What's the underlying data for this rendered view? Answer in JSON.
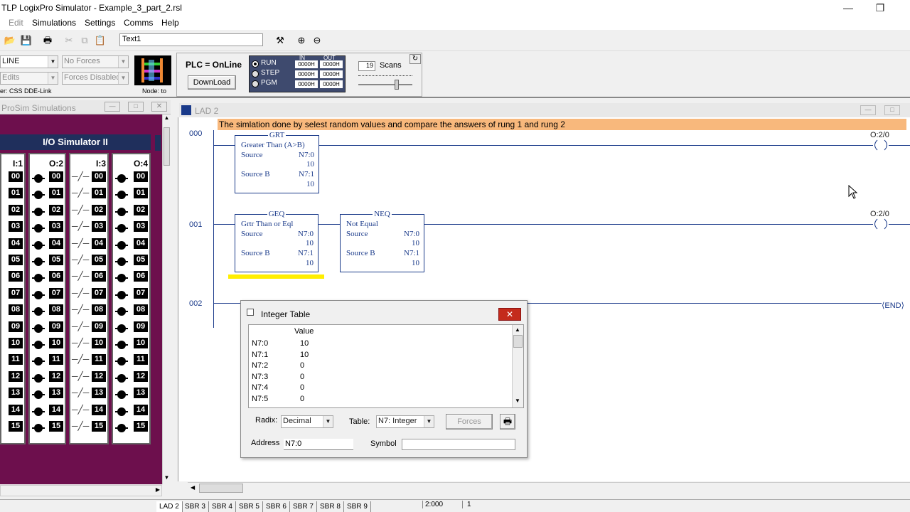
{
  "window": {
    "title": "TLP LogixPro Simulator  -  Example_3_part_2.rsl"
  },
  "menu": [
    "Edit",
    "Simulations",
    "Settings",
    "Comms",
    "Help"
  ],
  "toolbar": {
    "text_field": "Text1"
  },
  "controls": {
    "mode_combo": "LINE",
    "edits_combo": "Edits",
    "forces_combo": "No Forces",
    "forces_enable_combo": "Forces Disabled",
    "driver_label": "er: CSS DDE-Link",
    "node_label": "Node: to",
    "plc_status": "PLC = OnLine",
    "download_label": "DownLoad",
    "run_label": "RUN",
    "step_label": "STEP",
    "pgm_label": "PGM",
    "in_label": "IN",
    "out_label": "OUT",
    "io_values": [
      "0000H",
      "0000H",
      "0000H",
      "0000H",
      "0000H",
      "0000H"
    ],
    "scans_value": "19",
    "scans_label": "Scans"
  },
  "prosim": {
    "title": "ProSim Simulations",
    "io_title": "I/O Simulator II",
    "columns": [
      "I:1",
      "O:2",
      "I:3",
      "O:4"
    ],
    "rows": [
      "00",
      "01",
      "02",
      "03",
      "04",
      "05",
      "06",
      "07",
      "08",
      "09",
      "10",
      "11",
      "12",
      "13",
      "14",
      "15"
    ]
  },
  "ladder": {
    "title": "LAD 2",
    "comment": "The simlation done by selest random values and compare the answers of rung 1 and rung 2",
    "rungs": [
      "000",
      "001",
      "002"
    ],
    "grt": {
      "name": "GRT",
      "desc": "Greater Than (A>B)",
      "source": "Source",
      "source_addr": "N7:0",
      "source_val": "10",
      "sourceb": "Source B",
      "sourceb_addr": "N7:1",
      "sourceb_val": "10"
    },
    "geq": {
      "name": "GEQ",
      "desc": "Grtr Than or Eql",
      "source": "Source",
      "source_addr": "N7:0",
      "source_val": "10",
      "sourceb": "Source B",
      "sourceb_addr": "N7:1",
      "sourceb_val": "10"
    },
    "neq": {
      "name": "NEQ",
      "desc": "Not Equal",
      "source": "Source",
      "source_addr": "N7:0",
      "source_val": "10",
      "sourceb": "Source B",
      "sourceb_addr": "N7:1",
      "sourceb_val": "10"
    },
    "coil0": "O:2/0",
    "coil1": "O:2/0",
    "end": "END"
  },
  "int_table": {
    "title": "Integer Table",
    "col_header": "Value",
    "rows": [
      {
        "addr": "N7:0",
        "val": "10"
      },
      {
        "addr": "N7:1",
        "val": "10"
      },
      {
        "addr": "N7:2",
        "val": "0"
      },
      {
        "addr": "N7:3",
        "val": "0"
      },
      {
        "addr": "N7:4",
        "val": "0"
      },
      {
        "addr": "N7:5",
        "val": "0"
      }
    ],
    "radix_label": "Radix:",
    "radix_value": "Decimal",
    "table_label": "Table:",
    "table_value": "N7: Integer",
    "forces_label": "Forces",
    "address_label": "Address",
    "address_value": "N7:0",
    "symbol_label": "Symbol",
    "symbol_value": ""
  },
  "status": {
    "tabs": [
      "LAD 2",
      "SBR 3",
      "SBR 4",
      "SBR 5",
      "SBR 6",
      "SBR 7",
      "SBR 8",
      "SBR 9"
    ],
    "time": "2:000",
    "count": "1"
  },
  "colors": {
    "accent": "#1a3a8a",
    "prosim_bg": "#6d0f4d",
    "comment_bg": "#f8b87c",
    "highlight": "#ffee00"
  }
}
